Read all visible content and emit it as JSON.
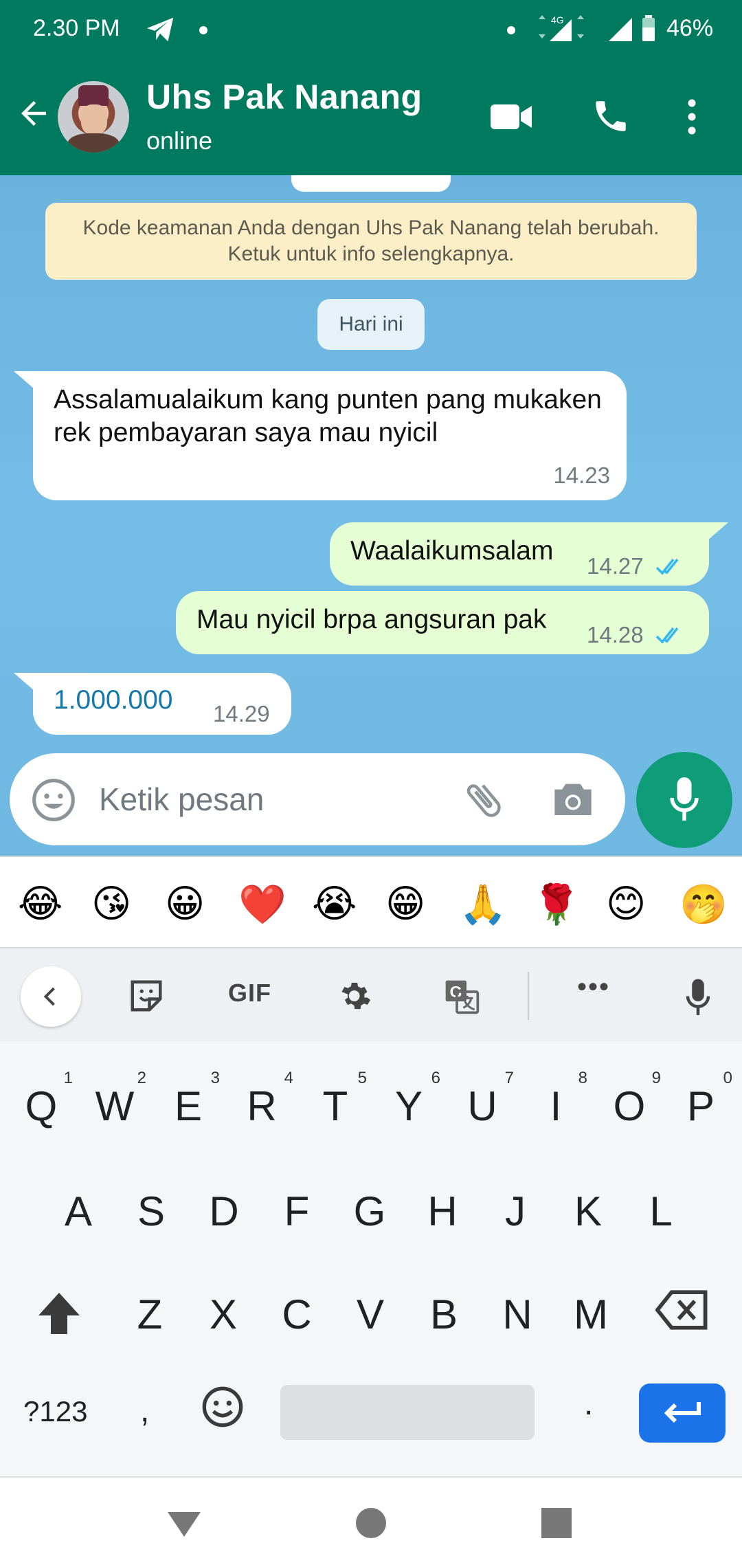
{
  "status_bar": {
    "time": "2.30 PM",
    "network": "4G",
    "battery": "46%"
  },
  "header": {
    "contact_name": "Uhs Pak Nanang",
    "status": "online"
  },
  "chat": {
    "security_notice": "Kode keamanan Anda dengan Uhs Pak Nanang telah berubah. Ketuk untuk info selengkapnya.",
    "day_label": "Hari ini",
    "messages": [
      {
        "direction": "in",
        "text": "Assalamualaikum kang punten pang mukaken rek pembayaran saya mau nyicil",
        "time": "14.23"
      },
      {
        "direction": "out",
        "text": "Waalaikumsalam",
        "time": "14.27",
        "status": "read"
      },
      {
        "direction": "out",
        "text": "Mau nyicil brpa angsuran pak",
        "time": "14.28",
        "status": "read"
      },
      {
        "direction": "in",
        "text": "1.000.000",
        "time": "14.29"
      }
    ]
  },
  "composer": {
    "placeholder": "Ketik pesan"
  },
  "emoji_suggestions": [
    "😂",
    "😘",
    "😀",
    "❤️",
    "😭",
    "😁",
    "🙏",
    "🌹",
    "😊",
    "🤭"
  ],
  "keyboard_toolbar": {
    "gif_label": "GIF",
    "more_label": "•••"
  },
  "keyboard": {
    "row1": [
      {
        "key": "Q",
        "hint": "1"
      },
      {
        "key": "W",
        "hint": "2"
      },
      {
        "key": "E",
        "hint": "3"
      },
      {
        "key": "R",
        "hint": "4"
      },
      {
        "key": "T",
        "hint": "5"
      },
      {
        "key": "Y",
        "hint": "6"
      },
      {
        "key": "U",
        "hint": "7"
      },
      {
        "key": "I",
        "hint": "8"
      },
      {
        "key": "O",
        "hint": "9"
      },
      {
        "key": "P",
        "hint": "0"
      }
    ],
    "row2": [
      "A",
      "S",
      "D",
      "F",
      "G",
      "H",
      "J",
      "K",
      "L"
    ],
    "row3": [
      "Z",
      "X",
      "C",
      "V",
      "B",
      "N",
      "M"
    ],
    "symbols_label": "?123",
    "comma": ",",
    "period": "."
  },
  "colors": {
    "header_green": "#007a5e",
    "outgoing_bubble": "#e6fed3",
    "mic_button": "#0e9d78",
    "read_ticks": "#34b7f1",
    "enter_key": "#1a73e8"
  }
}
